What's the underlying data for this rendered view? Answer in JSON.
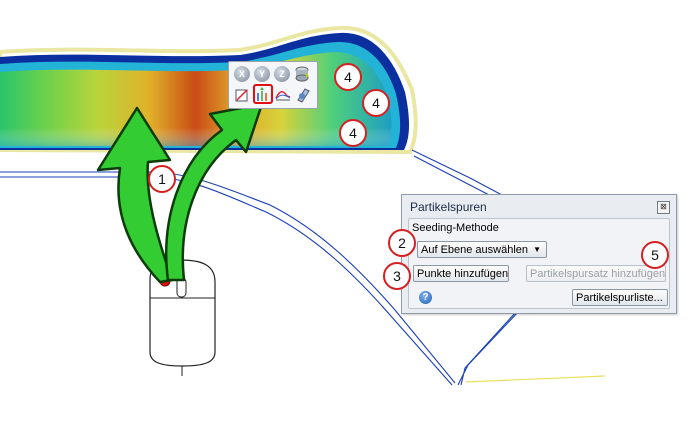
{
  "dialog": {
    "title": "Partikelspuren",
    "close_glyph": "⊠",
    "group_label": "Seeding-Methode",
    "seeding_method_value": "Auf Ebene auswählen",
    "add_points_label": "Punkte hinzufügen",
    "add_set_label": "Partikelspursatz hinzufügen",
    "list_label": "Partikelspurliste...",
    "help_glyph": "?"
  },
  "toolbar": {
    "x_label": "X",
    "y_label": "Y",
    "z_label": "Z"
  },
  "callouts": {
    "c1": "1",
    "c2": "2",
    "c3": "3",
    "c4a": "4",
    "c4b": "4",
    "c4c": "4",
    "c5": "5"
  },
  "icons": {
    "mouse": "computer-mouse-icon",
    "arrows": "curved-arrow-icon",
    "particle_trace": "particle-trace-icon"
  },
  "colors": {
    "callout_border": "#d42020",
    "arrow_fill": "#33cc33",
    "arrow_stroke": "#0c3b0c",
    "contour_outer": "#0b2f9e"
  }
}
